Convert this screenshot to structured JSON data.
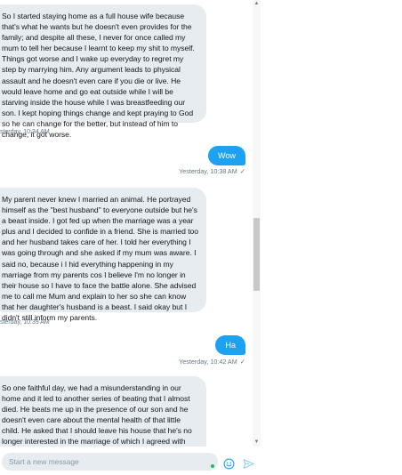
{
  "conversation": {
    "msg1": {
      "text": "So I started staying home as a full house wife because that's what he wants but he doesn't even provides for the family; and despite all these, I never for once called my mum to tell her because I learnt to keep my shit to myself. Things got worse and I wake up everyday to regret my step by marrying him. Any argument leads to physical assault and he doesn't even care if you die or live. He would leave home and go eat outside while I will be starving inside the house while I was breastfeeding our son. I kept hoping things change and kept praying to God so he can change for the better, but instead of him to change, it got worse.",
      "time": "sterday, 10:34 AM"
    },
    "msg2": {
      "text": "Wow",
      "time": "Yesterday, 10:38 AM",
      "status": "✓"
    },
    "msg3": {
      "text": "My parent never knew I married an animal. He portrayed himself as the \"best husband\" to everyone outside but he's a beast inside. I got fed up when the marriage was a year plus and I decided to confide in a friend. She is married too and her husband takes care of her. I told her everything I was going through and she asked if my mum was aware. I said no, because i I hid everything happening in my marriage from my parents cos I believe I'm no longer in their house so I have to face the battle alone. She advised me to call me Mum and explain to her so she can know that her daughter's husband is a beast. I said okay but I didn't still inform my parents.",
      "time": "sterday, 10:39 AM"
    },
    "msg4": {
      "text": "Ha",
      "time": "Yesterday, 10:42 AM",
      "status": "✓"
    },
    "msg5": {
      "text": "So one faithful day, we had a misunderstanding in our home and it led to another series of beating that I almost died. He beats me up in the presence of our son and he doesn't even care about the mental health of that little child. He asked that I should leave his house that he's no longer interested in the marriage of which I agreed with because I was also fed up with the daily physical assaults."
    }
  },
  "composer": {
    "placeholder": "Start a new message"
  },
  "icons": {
    "emoji": "emoji-icon",
    "send": "send-icon",
    "scroll_up": "▲",
    "scroll_down": "▼"
  },
  "colors": {
    "accent": "#1da1f2",
    "incoming_bubble": "#e6ecf0",
    "meta_text": "#657786"
  }
}
